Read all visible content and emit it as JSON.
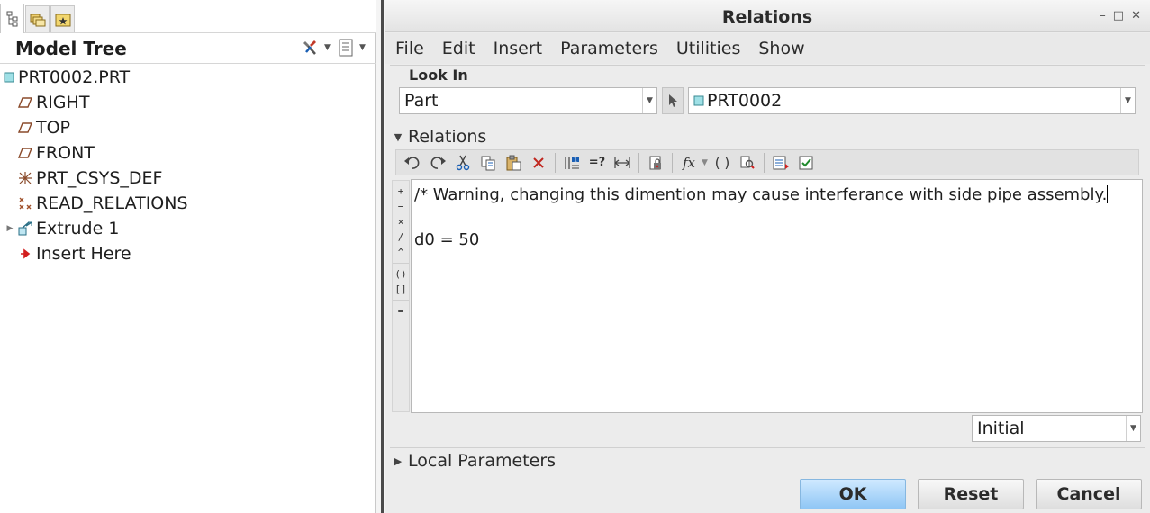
{
  "left_panel": {
    "tabs": [
      {
        "icon": "model-tree-icon"
      },
      {
        "icon": "folder-browser-icon"
      },
      {
        "icon": "favorites-icon"
      }
    ],
    "title": "Model Tree",
    "tree": {
      "root": "PRT0002.PRT",
      "items": [
        {
          "label": "RIGHT",
          "icon": "datum-plane-icon"
        },
        {
          "label": "TOP",
          "icon": "datum-plane-icon"
        },
        {
          "label": "FRONT",
          "icon": "datum-plane-icon"
        },
        {
          "label": "PRT_CSYS_DEF",
          "icon": "coordinate-system-icon"
        },
        {
          "label": "READ_RELATIONS",
          "icon": "datum-points-icon"
        },
        {
          "label": "Extrude 1",
          "icon": "extrude-icon"
        },
        {
          "label": "Insert Here",
          "icon": "insert-arrow-icon"
        }
      ]
    }
  },
  "dialog": {
    "title": "Relations",
    "menu": [
      "File",
      "Edit",
      "Insert",
      "Parameters",
      "Utilities",
      "Show"
    ],
    "look_in": {
      "label": "Look In",
      "type_value": "Part",
      "object_value": "PRT0002"
    },
    "relations_section": "Relations",
    "editor_lines": [
      "/* Warning, changing this dimention may cause interferance with side pipe assembly.",
      "",
      "d0 = 50"
    ],
    "side_operators": [
      "+",
      "−",
      "×",
      "/",
      "^",
      "()",
      "[]",
      "="
    ],
    "mode_select": "Initial",
    "local_parameters_section": "Local Parameters",
    "buttons": {
      "ok": "OK",
      "reset": "Reset",
      "cancel": "Cancel"
    },
    "accent_color": "#9dcdf7"
  }
}
